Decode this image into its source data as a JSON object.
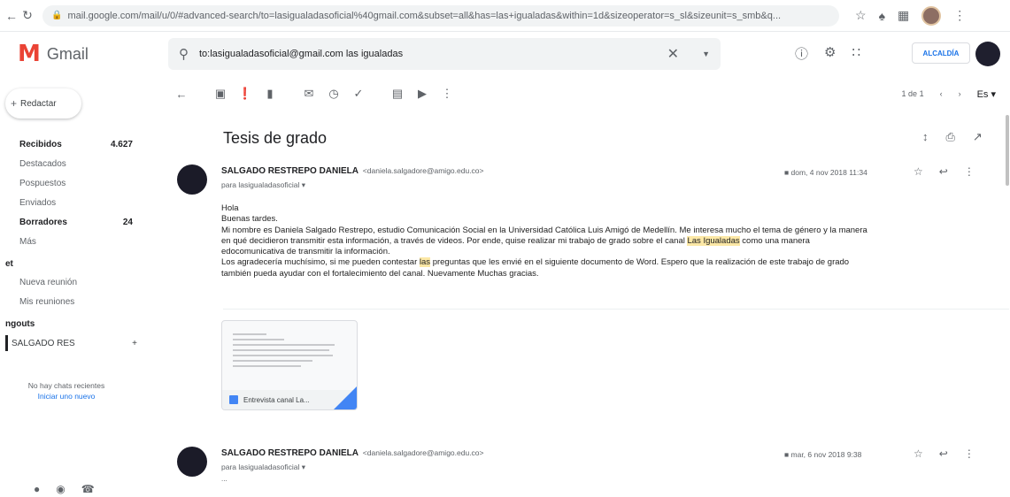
{
  "browser": {
    "url": "mail.google.com/mail/u/0/#advanced-search/to=lasigualadasoficial%40gmail.com&subset=all&has=las+igualadas&within=1d&sizeoperator=s_sl&sizeunit=s_smb&q..."
  },
  "header": {
    "app_name": "Gmail",
    "search_query": "to:lasigualadasoficial@gmail.com las igualadas",
    "org_label": "ALCALDÍA"
  },
  "sidebar": {
    "compose_label": "Redactar",
    "folders": [
      {
        "label": "Recibidos",
        "count": "4.627",
        "bold": true
      },
      {
        "label": "Destacados",
        "count": ""
      },
      {
        "label": "Pospuestos",
        "count": ""
      },
      {
        "label": "Enviados",
        "count": ""
      },
      {
        "label": "Borradores",
        "count": "24",
        "bold": true
      },
      {
        "label": "Más",
        "count": ""
      }
    ],
    "meet_title": "et",
    "meet_items": [
      "Nueva reunión",
      "Mis reuniones"
    ],
    "hangouts_title": "ngouts",
    "hangouts_user": "SALGADO RES",
    "empty_text": "No hay chats recientes",
    "empty_link": "Iniciar uno nuevo"
  },
  "toolbar": {
    "pager": "1 de 1",
    "lang": "Es"
  },
  "thread": {
    "subject": "Tesis de grado",
    "messages": [
      {
        "sender": "SALGADO RESTREPO DANIELA",
        "email": "<daniela.salgadore@amigo.edu.co>",
        "to": "para lasigualadasoficial",
        "date": "dom, 4 nov 2018 11:34",
        "lines": [
          "Hola",
          "Buenas tardes.",
          "Mi nombre es Daniela Salgado Restrepo, estudio Comunicación Social en la Universidad Católica Luis Amigó de Medellín. Me interesa mucho el tema de género y la manera",
          "en qué decidieron transmitir esta información, a través de videos. Por ende, quise realizar mi trabajo de grado sobre el canal",
          "Las Igualadas",
          "como una manera",
          "edocomunicativa de transmitir la información.",
          "Los agradecería muchísimo, si me pueden contestar",
          "las",
          "preguntas que les envié en el siguiente documento de Word. Espero que la realización de este trabajo de grado",
          "también pueda ayudar con el fortalecimiento del canal. Nuevamente Muchas gracias."
        ],
        "attachment": "Entrevista canal La..."
      },
      {
        "sender": "SALGADO RESTREPO DANIELA",
        "email": "<daniela.salgadore@amigo.edu.co>",
        "to": "para lasigualadasoficial",
        "date": "mar, 6 nov 2018 9:38",
        "snippet": "..."
      }
    ]
  }
}
